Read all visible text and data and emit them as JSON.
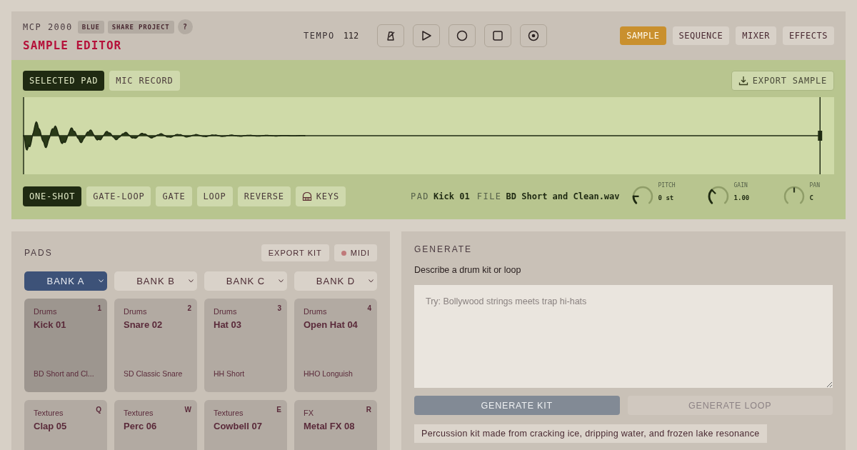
{
  "header": {
    "brand": "MCP 2000",
    "badges": [
      "BLUE",
      "SHARE PROJECT"
    ],
    "help": "?",
    "title": "SAMPLE EDITOR",
    "tempo_label": "TEMPO",
    "tempo": "112",
    "tabs": [
      {
        "label": "SAMPLE",
        "selected": true
      },
      {
        "label": "SEQUENCE",
        "selected": false
      },
      {
        "label": "MIXER",
        "selected": false
      },
      {
        "label": "EFFECTS",
        "selected": false
      }
    ]
  },
  "editor": {
    "sources": [
      {
        "label": "SELECTED PAD",
        "selected": true
      },
      {
        "label": "MIC RECORD",
        "selected": false
      }
    ],
    "export": "EXPORT SAMPLE",
    "modes": [
      {
        "label": "ONE-SHOT",
        "selected": true
      },
      {
        "label": "GATE-LOOP",
        "selected": false
      },
      {
        "label": "GATE",
        "selected": false
      },
      {
        "label": "LOOP",
        "selected": false
      },
      {
        "label": "REVERSE",
        "selected": false
      }
    ],
    "keys": "KEYS",
    "pad_label": "PAD",
    "pad": "Kick 01",
    "file_label": "FILE",
    "file": "BD Short and Clean.wav",
    "knobs": [
      {
        "label": "PITCH",
        "value": "0 st",
        "level": 0.17,
        "active": true
      },
      {
        "label": "GAIN",
        "value": "1.00",
        "level": 0.33,
        "active": true
      },
      {
        "label": "PAN",
        "value": "C",
        "level": 0.5,
        "active": false
      }
    ]
  },
  "pads": {
    "title": "PADS",
    "export": "EXPORT KIT",
    "midi": {
      "label": "MIDI",
      "connected": false
    },
    "banks": [
      {
        "label": "BANK A",
        "selected": true
      },
      {
        "label": "BANK B",
        "selected": false
      },
      {
        "label": "BANK C",
        "selected": false
      },
      {
        "label": "BANK D",
        "selected": false
      }
    ],
    "items": [
      {
        "category": "Drums",
        "name": "Kick 01",
        "key": "1",
        "sample": "BD Short and Cl...",
        "selected": true
      },
      {
        "category": "Drums",
        "name": "Snare 02",
        "key": "2",
        "sample": "SD Classic Snare",
        "selected": false
      },
      {
        "category": "Drums",
        "name": "Hat 03",
        "key": "3",
        "sample": "HH Short",
        "selected": false
      },
      {
        "category": "Drums",
        "name": "Open Hat 04",
        "key": "4",
        "sample": "HHO Longuish",
        "selected": false
      },
      {
        "category": "Textures",
        "name": "Clap 05",
        "key": "Q",
        "selected": false
      },
      {
        "category": "Textures",
        "name": "Perc 06",
        "key": "W",
        "selected": false
      },
      {
        "category": "Textures",
        "name": "Cowbell 07",
        "key": "E",
        "selected": false
      },
      {
        "category": "FX",
        "name": "Metal FX 08",
        "key": "R",
        "selected": false
      }
    ]
  },
  "generate": {
    "title": "GENERATE",
    "label": "Describe a drum kit or loop",
    "placeholder": "Try: Bollywood strings meets trap hi-hats",
    "buttons": [
      {
        "label": "GENERATE KIT",
        "disabled": false
      },
      {
        "label": "GENERATE LOOP",
        "disabled": true
      }
    ],
    "suggestions": [
      "Percussion kit made from cracking ice, dripping water, and frozen lake resonance"
    ]
  }
}
